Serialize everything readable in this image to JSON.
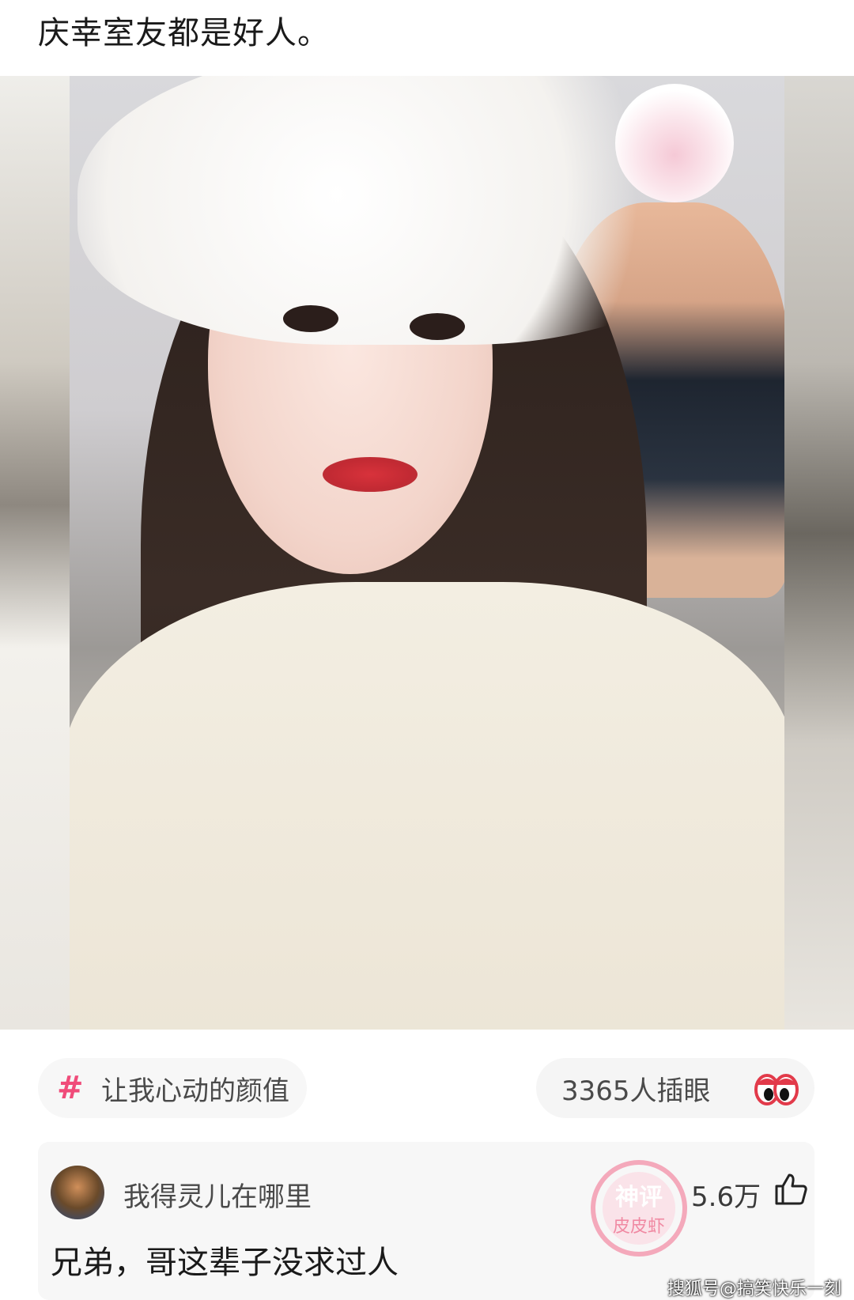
{
  "post": {
    "title": "庆幸室友都是好人。"
  },
  "tags": {
    "topic": {
      "label": "让我心动的颜值",
      "icon": "hash-icon"
    },
    "views": {
      "label": "3365人插眼",
      "icon": "eyes-icon"
    }
  },
  "comment": {
    "author": "我得灵儿在哪里",
    "text": "兄弟，哥这辈子没求过人",
    "likes": "5.6万",
    "stamp": {
      "line1": "神评",
      "line2": "皮皮虾"
    }
  },
  "watermark": "搜狐号@搞笑快乐一刻",
  "colors": {
    "accent": "#f04c7a",
    "stamp": "#f4a9bb"
  }
}
